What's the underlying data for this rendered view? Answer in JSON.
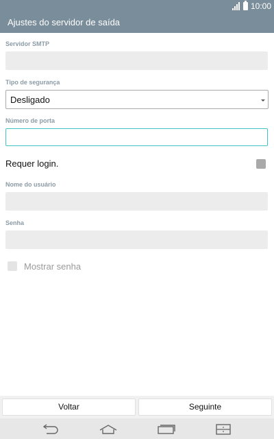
{
  "status_bar": {
    "time": "10:00"
  },
  "action_bar": {
    "title": "Ajustes do servidor de saída"
  },
  "form": {
    "smtp_server": {
      "label": "Servidor SMTP",
      "value": ""
    },
    "security_type": {
      "label": "Tipo de segurança",
      "selected": "Desligado"
    },
    "port_number": {
      "label": "Número de porta",
      "value": ""
    },
    "requires_login": {
      "label": "Requer login.",
      "checked": false
    },
    "username": {
      "label": "Nome do usuário",
      "value": ""
    },
    "password": {
      "label": "Senha",
      "value": ""
    },
    "show_password": {
      "label": "Mostrar senha",
      "checked": false
    }
  },
  "buttons": {
    "back": "Voltar",
    "next": "Seguinte"
  },
  "icons": {
    "signal": "signal-icon",
    "battery": "battery-icon",
    "dropdown": "dropdown-arrow-icon",
    "nav_back": "back-arrow-icon",
    "nav_home": "home-icon",
    "nav_recent": "recent-apps-icon",
    "nav_menu": "sim-menu-icon"
  },
  "colors": {
    "header": "#7a8d9a",
    "input_bg": "#ececec",
    "focus_border": "#3fc3c8",
    "label": "#8c9ba5"
  }
}
